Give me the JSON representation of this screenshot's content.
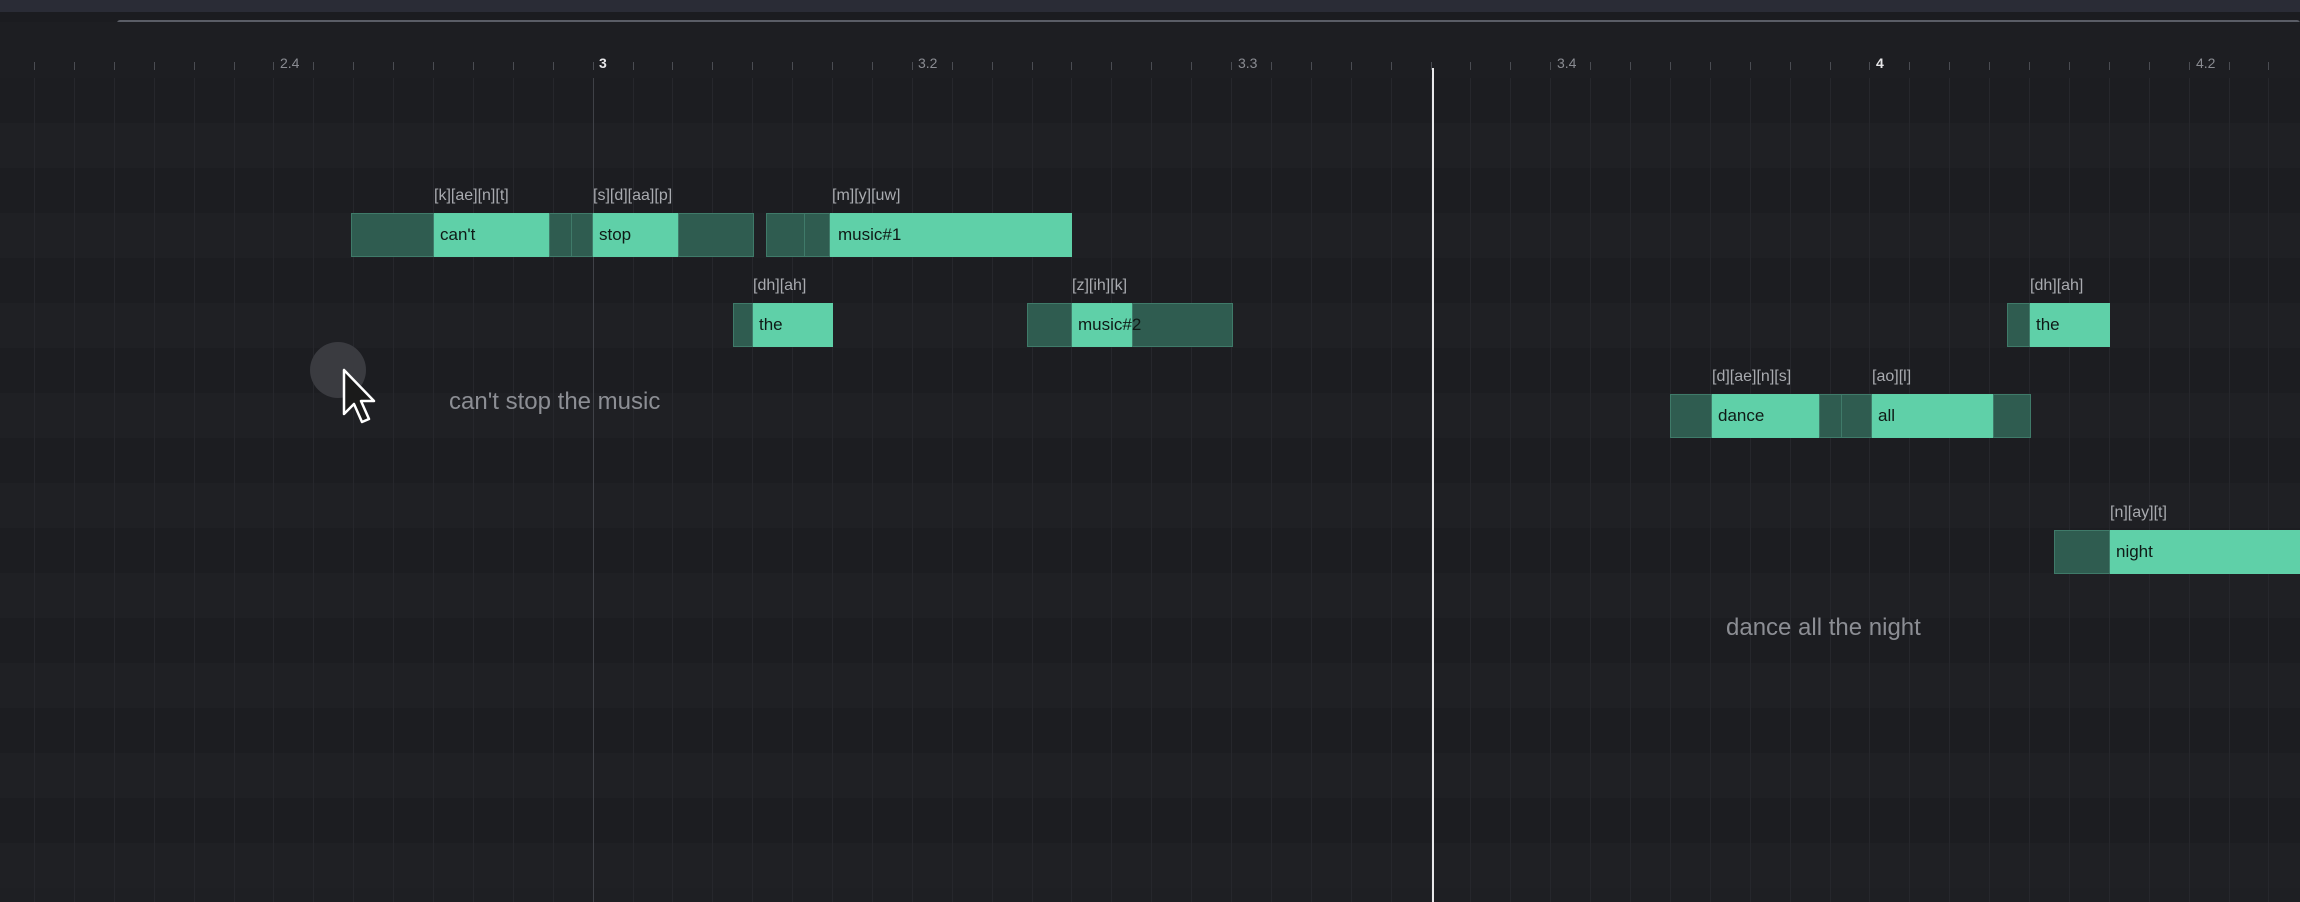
{
  "ruler": {
    "ticks": [
      {
        "label": "2.4",
        "major": false
      },
      {
        "label": "3",
        "major": true
      },
      {
        "label": "3.2",
        "major": false
      },
      {
        "label": "3.3",
        "major": false
      },
      {
        "label": "3.4",
        "major": false
      },
      {
        "label": "4",
        "major": true
      },
      {
        "label": "4.2",
        "major": false
      }
    ]
  },
  "notes": [
    {
      "word": "can't",
      "phonemes": "[k][ae][n][t]"
    },
    {
      "word": "stop",
      "phonemes": "[s][d][aa][p]"
    },
    {
      "word": "music#1",
      "phonemes": "[m][y][uw]"
    },
    {
      "word": "the",
      "phonemes": "[dh][ah]"
    },
    {
      "word": "music#2",
      "phonemes": "[z][ih][k]"
    },
    {
      "word": "the",
      "phonemes": "[dh][ah]"
    },
    {
      "word": "dance",
      "phonemes": "[d][ae][n][s]"
    },
    {
      "word": "all",
      "phonemes": "[ao][l]"
    },
    {
      "word": "night",
      "phonemes": "[n][ay][t]"
    }
  ],
  "lyrics": [
    {
      "text": "can't stop the music"
    },
    {
      "text": "dance all the night"
    }
  ],
  "colors": {
    "note_body": "#5fd0a8",
    "note_tail": "#2f5c50",
    "background": "#1e1f23",
    "playhead": "#e8e8ea"
  },
  "icons": {
    "cursor": "arrow-cursor-icon"
  }
}
